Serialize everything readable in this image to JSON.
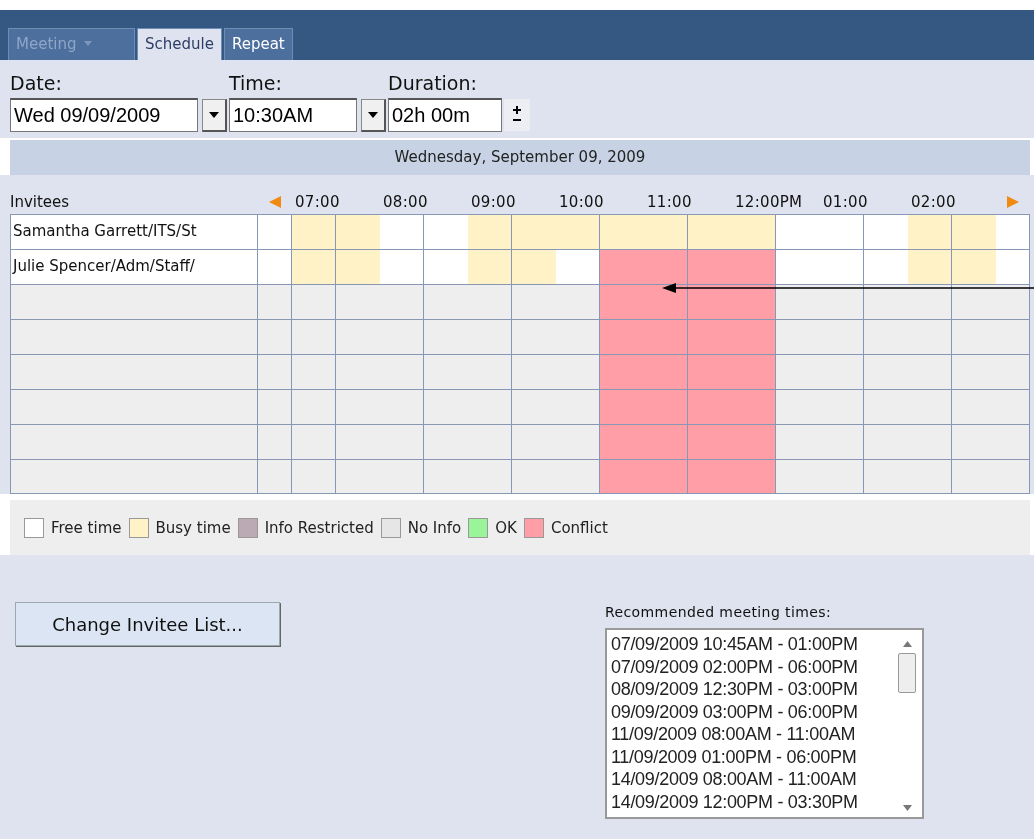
{
  "tabs": [
    {
      "label": "Meeting",
      "selected": false,
      "disabled": true,
      "has_menu": true
    },
    {
      "label": "Schedule",
      "selected": true,
      "disabled": false,
      "has_menu": false
    },
    {
      "label": "Repeat",
      "selected": false,
      "disabled": false,
      "has_menu": false
    }
  ],
  "fields": [
    {
      "label": "Date:",
      "value": "Wed 09/09/2009",
      "kind": "dropdown"
    },
    {
      "label": "Time:",
      "value": "10:30AM",
      "kind": "dropdown"
    },
    {
      "label": "Duration:",
      "value": "02h 00m",
      "kind": "spinner"
    }
  ],
  "day_header": "Wednesday, September 09, 2009",
  "schedule": {
    "invitees_heading": "Invitees",
    "hours": [
      "07:00",
      "08:00",
      "09:00",
      "10:00",
      "11:00",
      "12:00PM",
      "01:00",
      "02:00"
    ],
    "rows": [
      {
        "invitee": "Samantha Garrett/ITS/St",
        "cells": [
          {
            "kind": "free"
          },
          {
            "kind": "busy"
          },
          {
            "kind": "busy"
          },
          {
            "kind": "free"
          },
          {
            "kind": "free"
          },
          {
            "kind": "busy"
          },
          {
            "kind": "busy"
          },
          {
            "kind": "busy"
          },
          {
            "kind": "busy"
          },
          {
            "kind": "busy"
          },
          {
            "kind": "busy"
          },
          {
            "kind": "busy"
          },
          {
            "kind": "free"
          },
          {
            "kind": "free"
          },
          {
            "kind": "free"
          },
          {
            "kind": "busy"
          },
          {
            "kind": "busy"
          },
          {
            "kind": "free"
          }
        ]
      },
      {
        "invitee": "Julie Spencer/Adm/Staff/",
        "cells": [
          {
            "kind": "free"
          },
          {
            "kind": "busy"
          },
          {
            "kind": "busy"
          },
          {
            "kind": "free"
          },
          {
            "kind": "free"
          },
          {
            "kind": "busy"
          },
          {
            "kind": "busy"
          },
          {
            "kind": "free"
          },
          {
            "kind": "conflict"
          },
          {
            "kind": "conflict"
          },
          {
            "kind": "conflict"
          },
          {
            "kind": "conflict"
          },
          {
            "kind": "free"
          },
          {
            "kind": "free"
          },
          {
            "kind": "free"
          },
          {
            "kind": "busy"
          },
          {
            "kind": "busy"
          },
          {
            "kind": "free"
          }
        ]
      },
      {
        "cells": [
          {
            "kind": "noinfo"
          },
          {
            "kind": "noinfo"
          },
          {
            "kind": "noinfo"
          },
          {
            "kind": "noinfo"
          },
          {
            "kind": "noinfo"
          },
          {
            "kind": "noinfo"
          },
          {
            "kind": "noinfo"
          },
          {
            "kind": "noinfo"
          },
          {
            "kind": "conflict"
          },
          {
            "kind": "conflict"
          },
          {
            "kind": "conflict"
          },
          {
            "kind": "conflict"
          },
          {
            "kind": "noinfo"
          },
          {
            "kind": "noinfo"
          },
          {
            "kind": "noinfo"
          },
          {
            "kind": "noinfo"
          },
          {
            "kind": "noinfo"
          },
          {
            "kind": "noinfo"
          }
        ]
      },
      {
        "cells": [
          {
            "kind": "noinfo"
          },
          {
            "kind": "noinfo"
          },
          {
            "kind": "noinfo"
          },
          {
            "kind": "noinfo"
          },
          {
            "kind": "noinfo"
          },
          {
            "kind": "noinfo"
          },
          {
            "kind": "noinfo"
          },
          {
            "kind": "noinfo"
          },
          {
            "kind": "conflict"
          },
          {
            "kind": "conflict"
          },
          {
            "kind": "conflict"
          },
          {
            "kind": "conflict"
          },
          {
            "kind": "noinfo"
          },
          {
            "kind": "noinfo"
          },
          {
            "kind": "noinfo"
          },
          {
            "kind": "noinfo"
          },
          {
            "kind": "noinfo"
          },
          {
            "kind": "noinfo"
          }
        ]
      },
      {
        "cells": [
          {
            "kind": "noinfo"
          },
          {
            "kind": "noinfo"
          },
          {
            "kind": "noinfo"
          },
          {
            "kind": "noinfo"
          },
          {
            "kind": "noinfo"
          },
          {
            "kind": "noinfo"
          },
          {
            "kind": "noinfo"
          },
          {
            "kind": "noinfo"
          },
          {
            "kind": "conflict"
          },
          {
            "kind": "conflict"
          },
          {
            "kind": "conflict"
          },
          {
            "kind": "conflict"
          },
          {
            "kind": "noinfo"
          },
          {
            "kind": "noinfo"
          },
          {
            "kind": "noinfo"
          },
          {
            "kind": "noinfo"
          },
          {
            "kind": "noinfo"
          },
          {
            "kind": "noinfo"
          }
        ]
      },
      {
        "cells": [
          {
            "kind": "noinfo"
          },
          {
            "kind": "noinfo"
          },
          {
            "kind": "noinfo"
          },
          {
            "kind": "noinfo"
          },
          {
            "kind": "noinfo"
          },
          {
            "kind": "noinfo"
          },
          {
            "kind": "noinfo"
          },
          {
            "kind": "noinfo"
          },
          {
            "kind": "conflict"
          },
          {
            "kind": "conflict"
          },
          {
            "kind": "conflict"
          },
          {
            "kind": "conflict"
          },
          {
            "kind": "noinfo"
          },
          {
            "kind": "noinfo"
          },
          {
            "kind": "noinfo"
          },
          {
            "kind": "noinfo"
          },
          {
            "kind": "noinfo"
          },
          {
            "kind": "noinfo"
          }
        ]
      },
      {
        "cells": [
          {
            "kind": "noinfo"
          },
          {
            "kind": "noinfo"
          },
          {
            "kind": "noinfo"
          },
          {
            "kind": "noinfo"
          },
          {
            "kind": "noinfo"
          },
          {
            "kind": "noinfo"
          },
          {
            "kind": "noinfo"
          },
          {
            "kind": "noinfo"
          },
          {
            "kind": "conflict"
          },
          {
            "kind": "conflict"
          },
          {
            "kind": "conflict"
          },
          {
            "kind": "conflict"
          },
          {
            "kind": "noinfo"
          },
          {
            "kind": "noinfo"
          },
          {
            "kind": "noinfo"
          },
          {
            "kind": "noinfo"
          },
          {
            "kind": "noinfo"
          },
          {
            "kind": "noinfo"
          }
        ]
      },
      {
        "cells": [
          {
            "kind": "noinfo"
          },
          {
            "kind": "noinfo"
          },
          {
            "kind": "noinfo"
          },
          {
            "kind": "noinfo"
          },
          {
            "kind": "noinfo"
          },
          {
            "kind": "noinfo"
          },
          {
            "kind": "noinfo"
          },
          {
            "kind": "noinfo"
          },
          {
            "kind": "conflict"
          },
          {
            "kind": "conflict"
          },
          {
            "kind": "conflict"
          },
          {
            "kind": "conflict"
          },
          {
            "kind": "noinfo"
          },
          {
            "kind": "noinfo"
          },
          {
            "kind": "noinfo"
          },
          {
            "kind": "noinfo"
          },
          {
            "kind": "noinfo"
          },
          {
            "kind": "noinfo"
          }
        ]
      }
    ]
  },
  "legend": [
    {
      "label": "Free time",
      "color": "#ffffff"
    },
    {
      "label": "Busy time",
      "color": "#fff2c6"
    },
    {
      "label": "Info Restricted",
      "color": "#bba9b3"
    },
    {
      "label": "No Info",
      "color": "#e6e6e6"
    },
    {
      "label": "OK",
      "color": "#99f598"
    },
    {
      "label": "Conflict",
      "color": "#ff9ea6"
    }
  ],
  "change_button": "Change Invitee List...",
  "recommended": {
    "label": "Recommended meeting times:",
    "items": [
      "07/09/2009 10:45AM - 01:00PM",
      "07/09/2009 02:00PM - 06:00PM",
      "08/09/2009 12:30PM - 03:00PM",
      "09/09/2009 03:00PM - 06:00PM",
      "11/09/2009 08:00AM - 11:00AM",
      "11/09/2009 01:00PM - 06:00PM",
      "14/09/2009 08:00AM - 11:00AM",
      "14/09/2009 12:00PM - 03:30PM"
    ]
  }
}
